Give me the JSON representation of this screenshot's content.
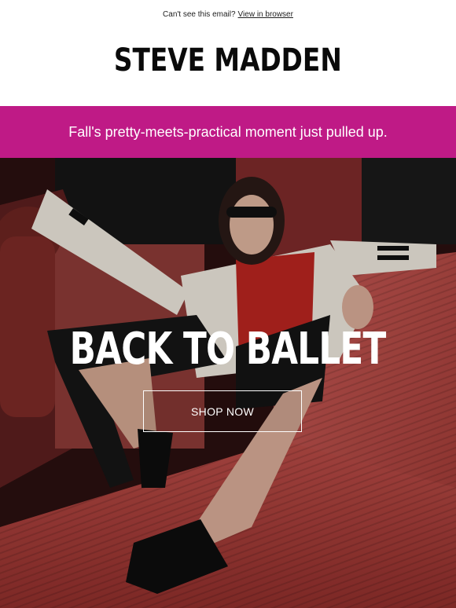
{
  "preheader": {
    "text": "Can't see this email?",
    "link": "View in browser"
  },
  "brand": {
    "logo_text": "STEVE MADDEN"
  },
  "promo": {
    "text": "Fall's pretty-meets-practical moment just pulled up.",
    "background": "#bf1a86"
  },
  "hero": {
    "headline": "BACK TO BALLET",
    "cta_label": "SHOP NOW"
  }
}
